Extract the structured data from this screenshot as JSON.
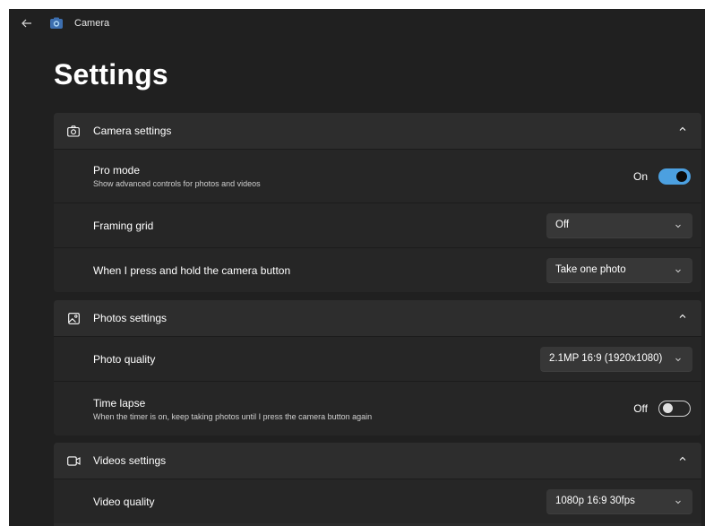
{
  "window": {
    "app_title": "Camera"
  },
  "page": {
    "title": "Settings"
  },
  "camera_settings": {
    "title": "Camera settings",
    "pro_mode": {
      "label": "Pro mode",
      "description": "Show advanced controls for photos and videos",
      "state": "On"
    },
    "framing_grid": {
      "label": "Framing grid",
      "value": "Off"
    },
    "hold_button": {
      "label": "When I press and hold the camera button",
      "value": "Take one photo"
    }
  },
  "photos_settings": {
    "title": "Photos settings",
    "photo_quality": {
      "label": "Photo quality",
      "value": "2.1MP 16:9 (1920x1080)"
    },
    "time_lapse": {
      "label": "Time lapse",
      "description": "When the timer is on, keep taking photos until I press the camera button again",
      "state": "Off"
    }
  },
  "videos_settings": {
    "title": "Videos settings",
    "video_quality": {
      "label": "Video quality",
      "value": "1080p 16:9 30fps"
    }
  },
  "colors": {
    "background": "#202020",
    "card": "#2b2b2b",
    "accent": "#4ca0e0",
    "dropdown": "#373737"
  }
}
